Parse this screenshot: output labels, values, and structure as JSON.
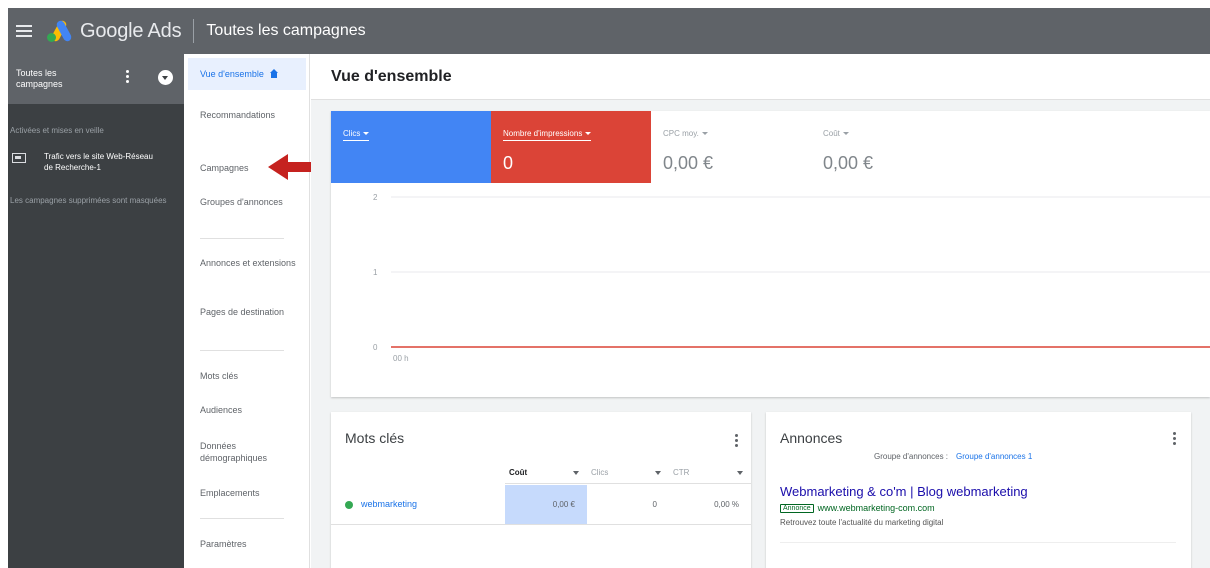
{
  "topbar": {
    "brand": "Google Ads",
    "title": "Toutes les campagnes"
  },
  "leftpanel": {
    "title": "Toutes les campagnes",
    "section": "Activées et mises en veille",
    "campaign": "Trafic vers le site Web-Réseau de Recherche-1",
    "note": "Les campagnes supprimées sont masquées"
  },
  "nav": {
    "active": "Vue d'ensemble",
    "items": [
      "Recommandations",
      "Campagnes",
      "Groupes d'annonces",
      "Annonces et extensions",
      "Pages de destination",
      "Mots clés",
      "Audiences",
      "Données démographiques",
      "Emplacements",
      "Paramètres"
    ]
  },
  "main": {
    "title": "Vue d'ensemble"
  },
  "metrics": [
    {
      "label": "Clics",
      "value": "",
      "color": "#4285f4"
    },
    {
      "label": "Nombre d'impressions",
      "value": "0",
      "color": "#db4437"
    },
    {
      "label": "CPC moy.",
      "value": "0,00 €"
    },
    {
      "label": "Coût",
      "value": "0,00 €"
    }
  ],
  "chart_data": {
    "type": "line",
    "y_ticks": [
      "2",
      "1",
      "0"
    ],
    "ylim": [
      0,
      2
    ],
    "x_tick": "00 h",
    "series": [
      {
        "values": [
          0,
          0
        ],
        "color": "#db4437"
      }
    ]
  },
  "keywords_card": {
    "title": "Mots clés",
    "headers": [
      "Coût",
      "Clics",
      "CTR"
    ],
    "row": {
      "keyword": "webmarketing",
      "cost": "0,00 €",
      "clicks": "0",
      "ctr": "0,00 %"
    }
  },
  "ads_card": {
    "title": "Annonces",
    "group_label": "Groupe d'annonces :",
    "group_link": "Groupe d'annonces 1",
    "headline": "Webmarketing & co'm | Blog webmarketing",
    "badge": "Annonce",
    "url": "www.webmarketing-com.com",
    "description": "Retrouvez toute l'actualité du marketing digital"
  }
}
